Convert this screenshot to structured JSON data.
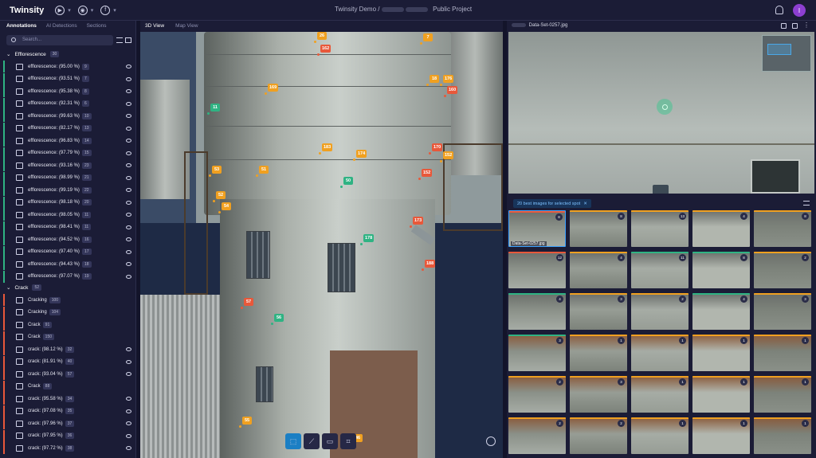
{
  "app": {
    "name": "Twinsity",
    "breadcrumb": "Twinsity Demo / ",
    "public_label": "Public Project",
    "avatar_initial": "I"
  },
  "left_panel": {
    "tabs": [
      "Annotations",
      "AI Detections",
      "Sections"
    ],
    "search_placeholder": "Search...",
    "groups": [
      {
        "label": "Efflorescence",
        "count": "30"
      },
      {
        "label": "Crack",
        "count": "52"
      }
    ],
    "efflorescence_items": [
      {
        "label": "efflorescence: (95.00 %)",
        "num": "9"
      },
      {
        "label": "efflorescence: (93.51 %)",
        "num": "7"
      },
      {
        "label": "efflorescence: (95.38 %)",
        "num": "8"
      },
      {
        "label": "efflorescence: (92.31 %)",
        "num": "6"
      },
      {
        "label": "efflorescence: (99.63 %)",
        "num": "10"
      },
      {
        "label": "efflorescence: (82.17 %)",
        "num": "13"
      },
      {
        "label": "efflorescence: (96.83 %)",
        "num": "14"
      },
      {
        "label": "efflorescence: (97.79 %)",
        "num": "15"
      },
      {
        "label": "efflorescence: (93.16 %)",
        "num": "23"
      },
      {
        "label": "efflorescence: (98.99 %)",
        "num": "21"
      },
      {
        "label": "efflorescence: (99.19 %)",
        "num": "22"
      },
      {
        "label": "efflorescence: (98.18 %)",
        "num": "20"
      },
      {
        "label": "efflorescence: (98.05 %)",
        "num": "11"
      },
      {
        "label": "efflorescence: (98.41 %)",
        "num": "11"
      },
      {
        "label": "efflorescence: (94.52 %)",
        "num": "16"
      },
      {
        "label": "efflorescence: (97.40 %)",
        "num": "17"
      },
      {
        "label": "efflorescence: (94.43 %)",
        "num": "18"
      },
      {
        "label": "efflorescence: (97.07 %)",
        "num": "19"
      }
    ],
    "crack_items": [
      {
        "label": "Cracking",
        "num": "100",
        "eye": false
      },
      {
        "label": "Cracking",
        "num": "104",
        "eye": false
      },
      {
        "label": "Crack",
        "num": "91",
        "eye": false
      },
      {
        "label": "Crack",
        "num": "150",
        "eye": false
      },
      {
        "label": "crack: (98.12 %)",
        "num": "32",
        "eye": true
      },
      {
        "label": "crack: (81.91 %)",
        "num": "40",
        "eye": true
      },
      {
        "label": "crack: (93.04 %)",
        "num": "57",
        "eye": true
      },
      {
        "label": "Crack",
        "num": "88",
        "eye": false
      },
      {
        "label": "crack: (95.58 %)",
        "num": "34",
        "eye": true
      },
      {
        "label": "crack: (97.08 %)",
        "num": "35",
        "eye": true
      },
      {
        "label": "crack: (97.96 %)",
        "num": "37",
        "eye": true
      },
      {
        "label": "crack: (97.95 %)",
        "num": "36",
        "eye": true
      },
      {
        "label": "crack: (97.72 %)",
        "num": "38",
        "eye": true
      }
    ]
  },
  "viewer": {
    "tabs": [
      "3D View",
      "Map View"
    ],
    "markers": [
      {
        "label": "26",
        "color": "#f0a020"
      },
      {
        "label": "7",
        "color": "#f0a020"
      },
      {
        "label": "162",
        "color": "#e8583a"
      },
      {
        "label": "169",
        "color": "#f0a020"
      },
      {
        "label": "18",
        "color": "#f0a020"
      },
      {
        "label": "176",
        "color": "#f0a020"
      },
      {
        "label": "160",
        "color": "#e8583a"
      },
      {
        "label": "11",
        "color": "#2fb383"
      },
      {
        "label": "183",
        "color": "#f0a020"
      },
      {
        "label": "174",
        "color": "#f0a020"
      },
      {
        "label": "170",
        "color": "#e8583a"
      },
      {
        "label": "152",
        "color": "#f0a020"
      },
      {
        "label": "53",
        "color": "#f0a020"
      },
      {
        "label": "51",
        "color": "#f0a020"
      },
      {
        "label": "152",
        "color": "#e8583a"
      },
      {
        "label": "50",
        "color": "#2fb383"
      },
      {
        "label": "52",
        "color": "#f0a020"
      },
      {
        "label": "54",
        "color": "#f0a020"
      },
      {
        "label": "173",
        "color": "#e8583a"
      },
      {
        "label": "178",
        "color": "#2fb383"
      },
      {
        "label": "188",
        "color": "#e8583a"
      },
      {
        "label": "57",
        "color": "#e8583a"
      },
      {
        "label": "56",
        "color": "#2fb383"
      },
      {
        "label": "55",
        "color": "#f0a020"
      },
      {
        "label": "46",
        "color": "#f0a020"
      }
    ]
  },
  "right_panel": {
    "image_name": "Data-Set-0257.jpg",
    "best_images_label": "20 best images for selected spot",
    "best_count": "20",
    "thumb_caption": "Data-Set-0257.jpg",
    "thumbnails": [
      {
        "badge": "8",
        "strip": "#e8583a"
      },
      {
        "badge": "8",
        "strip": "#f0a020"
      },
      {
        "badge": "13",
        "strip": "#f0a020"
      },
      {
        "badge": "4",
        "strip": "#f0a020"
      },
      {
        "badge": "8",
        "strip": "#f0a020"
      },
      {
        "badge": "12",
        "strip": "#e8583a"
      },
      {
        "badge": "4",
        "strip": "#f0a020"
      },
      {
        "badge": "11",
        "strip": "#2fb383"
      },
      {
        "badge": "8",
        "strip": "#2fb383"
      },
      {
        "badge": "2",
        "strip": "#f0a020"
      },
      {
        "badge": "4",
        "strip": "#2fb383"
      },
      {
        "badge": "3",
        "strip": "#f0a020"
      },
      {
        "badge": "2",
        "strip": "#f0a020"
      },
      {
        "badge": "4",
        "strip": "#2fb383"
      },
      {
        "badge": "3",
        "strip": "#f0a020"
      },
      {
        "badge": "3",
        "strip": "#2fb383"
      },
      {
        "badge": "1",
        "strip": "#f0a020"
      },
      {
        "badge": "1",
        "strip": "#f0a020"
      },
      {
        "badge": "1",
        "strip": "#f0a020"
      },
      {
        "badge": "1",
        "strip": "#f0a020"
      },
      {
        "badge": "2",
        "strip": "#f0a020"
      },
      {
        "badge": "3",
        "strip": "#f0a020"
      },
      {
        "badge": "1",
        "strip": "#f0a020"
      },
      {
        "badge": "1",
        "strip": "#f0a020"
      },
      {
        "badge": "1",
        "strip": "#f0a020"
      },
      {
        "badge": "2",
        "strip": "#f0a020"
      },
      {
        "badge": "2",
        "strip": "#f0a020"
      },
      {
        "badge": "1",
        "strip": "#f0a020"
      },
      {
        "badge": "1",
        "strip": "#f0a020"
      },
      {
        "badge": "1",
        "strip": "#f0a020"
      }
    ]
  },
  "colors": {
    "accent": "#1b7fc4",
    "bg": "#13142a",
    "panel": "#1b1c36"
  }
}
